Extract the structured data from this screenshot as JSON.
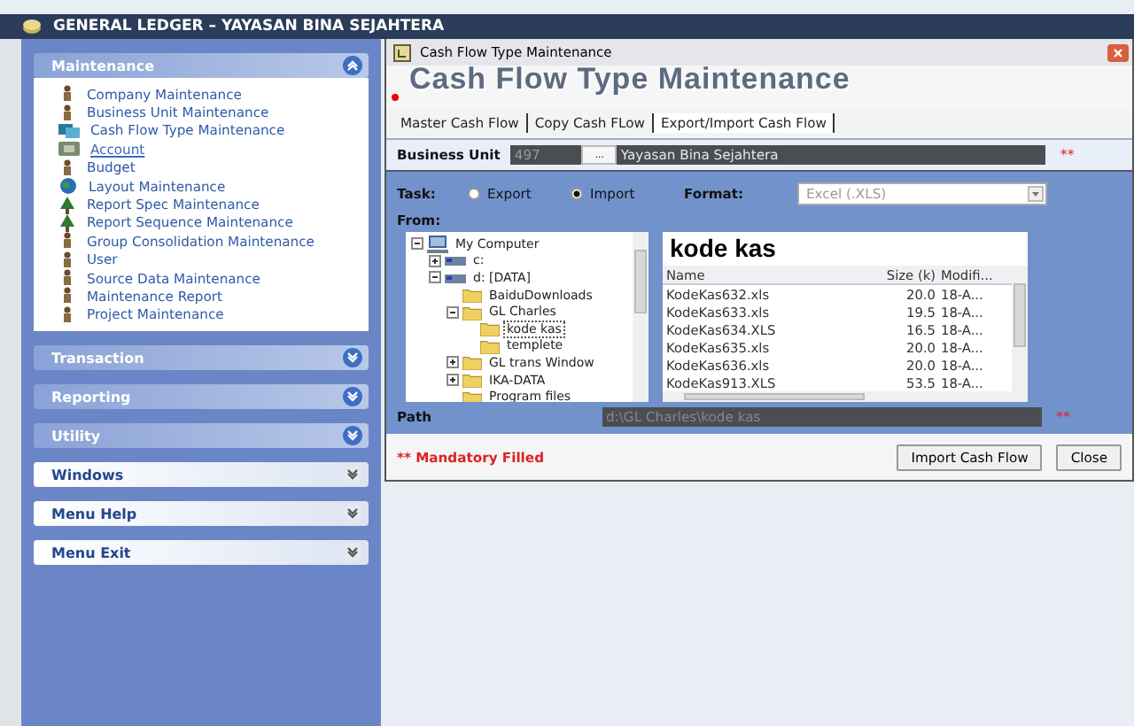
{
  "app_title": "GENERAL LEDGER – YAYASAN BINA SEJAHTERA",
  "sidebar": [
    {
      "title": "Maintenance",
      "expanded": true,
      "kind": "dark",
      "items": [
        {
          "label": "Company Maintenance",
          "kind": "figure",
          "selected": false
        },
        {
          "label": "Business Unit Maintenance",
          "kind": "figure",
          "selected": false
        },
        {
          "label": "Cash Flow Type Maintenance",
          "kind": "monitor",
          "selected": false
        },
        {
          "label": "Account",
          "kind": "box",
          "selected": true
        },
        {
          "label": "Budget",
          "kind": "figure",
          "selected": false
        },
        {
          "label": "Layout Maintenance",
          "kind": "globe",
          "selected": false
        },
        {
          "label": "Report Spec Maintenance",
          "kind": "tree",
          "selected": false
        },
        {
          "label": "Report Sequence Maintenance",
          "kind": "tree",
          "selected": false
        },
        {
          "label": "Group Consolidation Maintenance",
          "kind": "figure",
          "selected": false
        },
        {
          "label": "User",
          "kind": "figure",
          "selected": false
        },
        {
          "label": "Source Data Maintenance",
          "kind": "figure",
          "selected": false
        },
        {
          "label": "Maintenance Report",
          "kind": "figure",
          "selected": false
        },
        {
          "label": "Project Maintenance",
          "kind": "figure",
          "selected": false
        }
      ]
    },
    {
      "title": "Transaction",
      "expanded": false,
      "kind": "dark"
    },
    {
      "title": "Reporting",
      "expanded": false,
      "kind": "dark"
    },
    {
      "title": "Utility",
      "expanded": false,
      "kind": "dark"
    },
    {
      "title": "Windows",
      "expanded": false,
      "kind": "light"
    },
    {
      "title": "Menu Help",
      "expanded": false,
      "kind": "light"
    },
    {
      "title": "Menu Exit",
      "expanded": false,
      "kind": "light"
    }
  ],
  "window": {
    "title": "Cash Flow Type Maintenance",
    "banner": "Cash Flow Type Maintenance",
    "tabs": [
      {
        "label": "Master Cash Flow",
        "selected": false
      },
      {
        "label": "Copy Cash FLow",
        "selected": false
      },
      {
        "label": "Export/Import Cash Flow",
        "selected": true
      }
    ],
    "business_unit": {
      "label": "Business Unit",
      "code": "497",
      "name": "Yayasan Bina Sejahtera",
      "button": "...",
      "required": "**"
    },
    "task": {
      "label": "Task:",
      "options": [
        {
          "label": "Export",
          "selected": false
        },
        {
          "label": "Import",
          "selected": true
        }
      ]
    },
    "format": {
      "label": "Format:",
      "value": "Excel (.XLS)"
    },
    "from_label": "From:",
    "tree": [
      {
        "label": "My Computer",
        "kind": "computer",
        "expanded": true,
        "selected": false,
        "children": [
          {
            "label": "c:",
            "kind": "drive",
            "expanded": false,
            "selected": false
          },
          {
            "label": "d: [DATA]",
            "kind": "drive",
            "expanded": true,
            "selected": false,
            "children": [
              {
                "label": "BaiduDownloads",
                "kind": "folder",
                "selected": false
              },
              {
                "label": "GL Charles",
                "kind": "folder",
                "expanded": true,
                "selected": false,
                "children": [
                  {
                    "label": "kode kas",
                    "kind": "folder",
                    "selected": true
                  },
                  {
                    "label": "templete",
                    "kind": "folder",
                    "selected": false
                  }
                ]
              },
              {
                "label": "GL trans Window",
                "kind": "folder",
                "expanded": false,
                "selected": false
              },
              {
                "label": "IKA-DATA",
                "kind": "folder",
                "expanded": false,
                "selected": false
              },
              {
                "label": "Program files",
                "kind": "folder",
                "selected": false
              }
            ]
          }
        ]
      }
    ],
    "folder_title": "kode kas",
    "columns": [
      "Name",
      "Size (k)",
      "Modifi..."
    ],
    "files": [
      {
        "name": "KodeKas632.xls",
        "size": "20.0",
        "modified": "18-A..."
      },
      {
        "name": "KodeKas633.xls",
        "size": "19.5",
        "modified": "18-A..."
      },
      {
        "name": "KodeKas634.XLS",
        "size": "16.5",
        "modified": "18-A..."
      },
      {
        "name": "KodeKas635.xls",
        "size": "20.0",
        "modified": "18-A..."
      },
      {
        "name": "KodeKas636.xls",
        "size": "20.0",
        "modified": "18-A..."
      },
      {
        "name": "KodeKas913.XLS",
        "size": "53.5",
        "modified": "18-A..."
      }
    ],
    "path": {
      "label": "Path",
      "value": "d:\\GL Charles\\kode kas",
      "required": "**"
    },
    "mandatory": "** Mandatory Filled",
    "buttons": [
      "Import Cash Flow",
      "Close"
    ]
  }
}
